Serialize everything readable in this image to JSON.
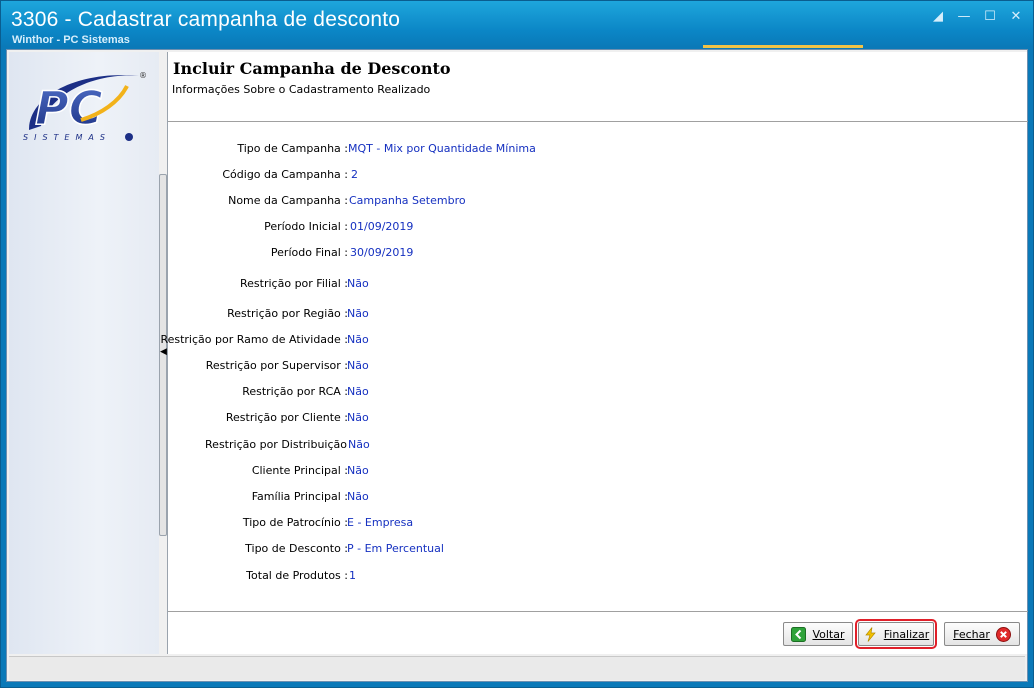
{
  "window": {
    "title": "3306 - Cadastrar campanha de desconto",
    "subtitle": "Winthor - PC Sistemas"
  },
  "logo": {
    "text": "PC",
    "tagline": "SISTEMAS"
  },
  "header": {
    "title": "Incluir Campanha de Desconto",
    "subtitle": "Informações Sobre o Cadastramento Realizado"
  },
  "summary": [
    {
      "label": "Tipo de Campanha :",
      "value": "MQT - Mix por Quantidade Mínima"
    },
    {
      "label": "Código da Campanha :",
      "value": "2"
    },
    {
      "label": "Nome da Campanha :",
      "value": "Campanha Setembro"
    },
    {
      "label": "Período Inicial :",
      "value": "01/09/2019"
    },
    {
      "label": "Período Final :",
      "value": "30/09/2019"
    },
    {
      "label": "Restrição por Filial :",
      "value": "Não"
    },
    {
      "label": "Restrição por Região :",
      "value": "Não"
    },
    {
      "label": "Restrição por Ramo de Atividade :",
      "value": "Não"
    },
    {
      "label": "Restrição por Supervisor :",
      "value": "Não"
    },
    {
      "label": "Restrição por RCA :",
      "value": "Não"
    },
    {
      "label": "Restrição por Cliente :",
      "value": "Não"
    },
    {
      "label": "Restrição por Distribuição",
      "value": "Não"
    },
    {
      "label": "Cliente Principal :",
      "value": "Não"
    },
    {
      "label": "Família Principal :",
      "value": "Não"
    },
    {
      "label": "Tipo de Patrocínio :",
      "value": "E - Empresa"
    },
    {
      "label": "Tipo de Desconto :",
      "value": "P - Em Percentual"
    },
    {
      "label": "Total de Produtos :",
      "value": "1"
    }
  ],
  "buttons": {
    "voltar": "Voltar",
    "finalizar": "Finalizar",
    "fechar": "Fechar"
  },
  "icons": {
    "voltar": "back-arrow-icon",
    "finalizar": "lightning-icon",
    "fechar": "close-circle-icon"
  },
  "colors": {
    "value_text": "#1530c0",
    "title_bar": "#0b86c6",
    "highlight": "#e0202a"
  }
}
